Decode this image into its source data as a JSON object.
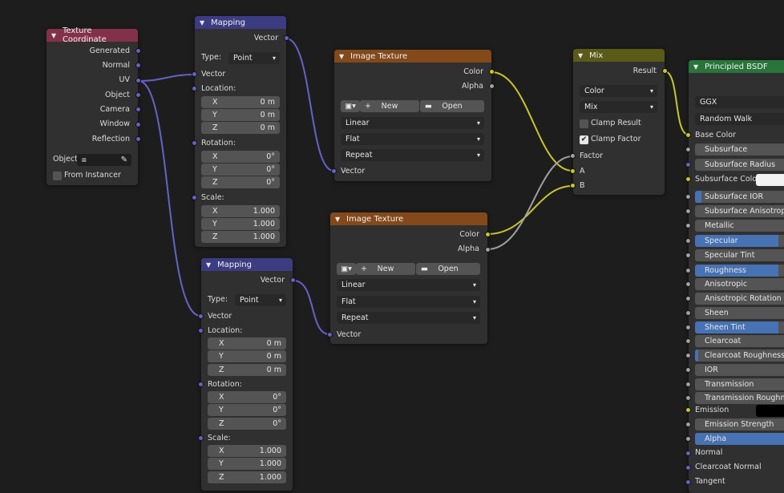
{
  "colors": {
    "input_header": "#83314a",
    "vector_header": "#3c3c83",
    "texture_header": "#83491a",
    "converter_header": "#595b16",
    "shader_header": "#29743b",
    "socket_vector": "#6363c7",
    "socket_color": "#c7c729",
    "socket_float": "#a1a1a1",
    "slider_fill": "#4772b3"
  },
  "tex_coord": {
    "title": "Texture Coordinate",
    "outputs": [
      "Generated",
      "Normal",
      "UV",
      "Object",
      "Camera",
      "Window",
      "Reflection"
    ],
    "object_label": "Object:",
    "from_instancer": "From Instancer"
  },
  "mapping1": {
    "title": "Mapping",
    "output": "Vector",
    "type_label": "Type:",
    "type_value": "Point",
    "vector_input": "Vector",
    "location_label": "Location:",
    "location": [
      {
        "axis": "X",
        "value": "0 m"
      },
      {
        "axis": "Y",
        "value": "0 m"
      },
      {
        "axis": "Z",
        "value": "0 m"
      }
    ],
    "rotation_label": "Rotation:",
    "rotation": [
      {
        "axis": "X",
        "value": "0°"
      },
      {
        "axis": "Y",
        "value": "0°"
      },
      {
        "axis": "Z",
        "value": "0°"
      }
    ],
    "scale_label": "Scale:",
    "scale": [
      {
        "axis": "X",
        "value": "1.000"
      },
      {
        "axis": "Y",
        "value": "1.000"
      },
      {
        "axis": "Z",
        "value": "1.000"
      }
    ]
  },
  "mapping2": {
    "title": "Mapping",
    "output": "Vector",
    "type_label": "Type:",
    "type_value": "Point",
    "vector_input": "Vector",
    "location_label": "Location:",
    "location": [
      {
        "axis": "X",
        "value": "0 m"
      },
      {
        "axis": "Y",
        "value": "0 m"
      },
      {
        "axis": "Z",
        "value": "0 m"
      }
    ],
    "rotation_label": "Rotation:",
    "rotation": [
      {
        "axis": "X",
        "value": "0°"
      },
      {
        "axis": "Y",
        "value": "0°"
      },
      {
        "axis": "Z",
        "value": "0°"
      }
    ],
    "scale_label": "Scale:",
    "scale": [
      {
        "axis": "X",
        "value": "1.000"
      },
      {
        "axis": "Y",
        "value": "1.000"
      },
      {
        "axis": "Z",
        "value": "1.000"
      }
    ]
  },
  "imgtex1": {
    "title": "Image Texture",
    "outputs": [
      "Color",
      "Alpha"
    ],
    "new_label": "New",
    "open_label": "Open",
    "interpolation": "Linear",
    "projection": "Flat",
    "extension": "Repeat",
    "vector_input": "Vector"
  },
  "imgtex2": {
    "title": "Image Texture",
    "outputs": [
      "Color",
      "Alpha"
    ],
    "new_label": "New",
    "open_label": "Open",
    "interpolation": "Linear",
    "projection": "Flat",
    "extension": "Repeat",
    "vector_input": "Vector"
  },
  "mix": {
    "title": "Mix",
    "output": "Result",
    "data_type": "Color",
    "blend_mode": "Mix",
    "clamp_result": {
      "label": "Clamp Result",
      "checked": false
    },
    "clamp_factor": {
      "label": "Clamp Factor",
      "checked": true
    },
    "inputs": [
      "Factor",
      "A",
      "B"
    ]
  },
  "bsdf": {
    "title": "Principled BSDF",
    "distribution": "GGX",
    "subsurface_method": "Random Walk",
    "base_color_label": "Base Color",
    "subsurface": {
      "label": "Subsurface",
      "fill": 0
    },
    "subsurface_radius": "Subsurface Radius",
    "subsurface_color_label": "Subsurface Color",
    "sliders": [
      {
        "label": "Subsurface IOR",
        "fill": 0.06
      },
      {
        "label": "Subsurface Anisotropy",
        "fill": 0
      },
      {
        "label": "Metallic",
        "fill": 0
      },
      {
        "label": "Specular",
        "fill": 0.8
      },
      {
        "label": "Specular Tint",
        "fill": 0
      },
      {
        "label": "Roughness",
        "fill": 0.8
      },
      {
        "label": "Anisotropic",
        "fill": 0
      },
      {
        "label": "Anisotropic Rotation",
        "fill": 0
      },
      {
        "label": "Sheen",
        "fill": 0
      },
      {
        "label": "Sheen Tint",
        "fill": 0.8
      },
      {
        "label": "Clearcoat",
        "fill": 0
      },
      {
        "label": "Clearcoat Roughness",
        "fill": 0.03
      },
      {
        "label": "IOR",
        "fill": 0
      },
      {
        "label": "Transmission",
        "fill": 0
      },
      {
        "label": "Transmission Roughness",
        "fill": 0
      }
    ],
    "emission_label": "Emission",
    "emission_strength": {
      "label": "Emission Strength",
      "fill": 0
    },
    "alpha": {
      "label": "Alpha",
      "fill": 1.0
    },
    "normal_label": "Normal",
    "clearcoat_normal_label": "Clearcoat Normal",
    "tangent_label": "Tangent"
  }
}
